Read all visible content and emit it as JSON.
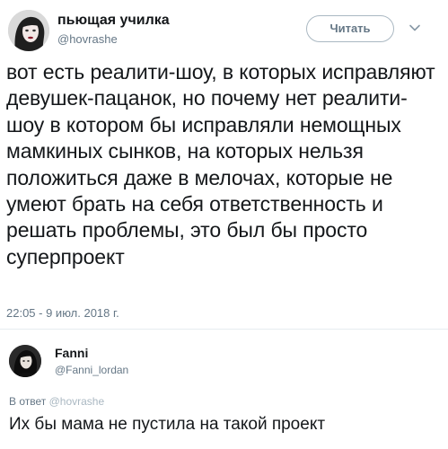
{
  "tweet": {
    "author_name": "пьющая училка",
    "author_handle": "@hovrashe",
    "follow_label": "Читать",
    "text": "вот есть реалити-шоу, в которых исправляют девушек-пацанок, но почему нет реалити-шоу в котором бы исправляли немощных мамкиных сынков, на которых нельзя положиться даже в мелочах, которые не умеют брать на себя ответственность и решать проблемы, это был бы просто суперпроект",
    "timestamp": "22:05 - 9 июл. 2018 г."
  },
  "reply": {
    "author_name": "Fanni",
    "author_handle": "@Fanni_lordan",
    "reply_to_prefix": "В ответ",
    "reply_to_handle": "@hovrashe",
    "text": "Их бы мама не пустила на такой проект"
  },
  "icons": {
    "more": "chevron-down-icon"
  },
  "colors": {
    "text": "#14171a",
    "secondary": "#657786",
    "button_border": "#aab8c2",
    "divider": "#e6ecf0"
  }
}
